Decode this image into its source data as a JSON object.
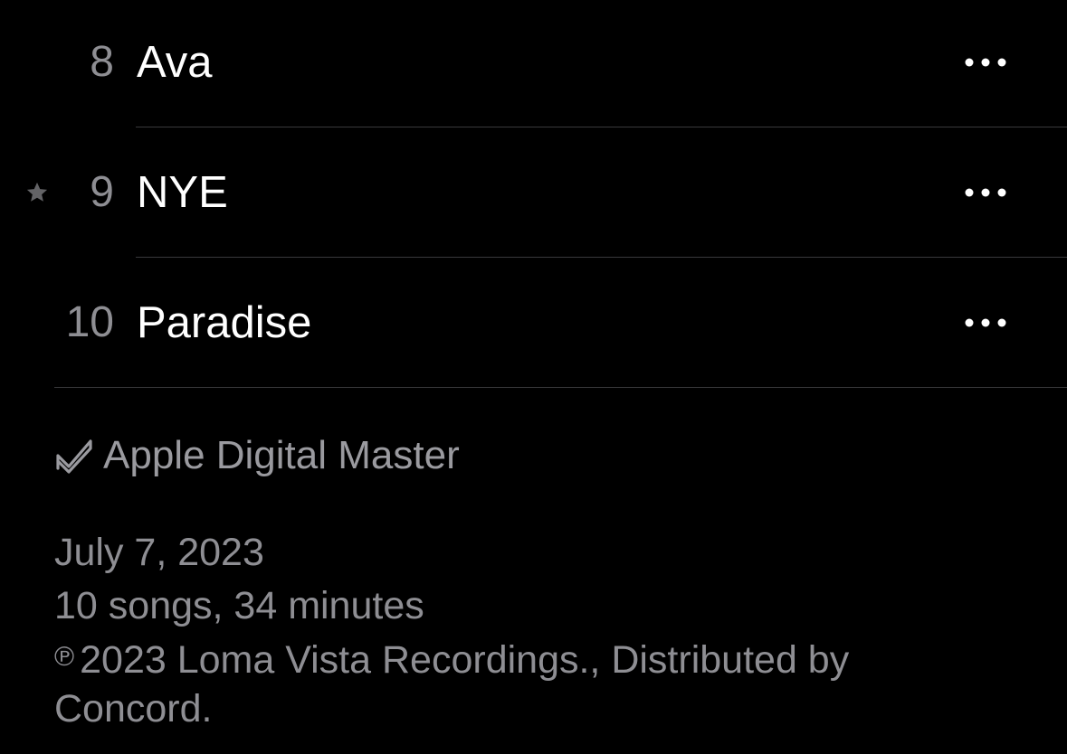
{
  "tracks": [
    {
      "number": "8",
      "title": "Ava",
      "starred": false
    },
    {
      "number": "9",
      "title": "NYE",
      "starred": true
    },
    {
      "number": "10",
      "title": "Paradise",
      "starred": false
    }
  ],
  "icons": {
    "star": "star-icon",
    "more": "ellipsis-icon",
    "mastered": "apple-digital-master-icon"
  },
  "footer": {
    "mastered_label": "Apple Digital Master",
    "release_date": "July 7, 2023",
    "summary": "10 songs, 34 minutes",
    "copyright_mark": "℗",
    "copyright_text": "2023 Loma Vista Recordings., Distributed by Concord."
  },
  "colors": {
    "background": "#000000",
    "primary_text": "#ffffff",
    "secondary_text": "#8e8e93",
    "separator": "#3a3a3c"
  }
}
